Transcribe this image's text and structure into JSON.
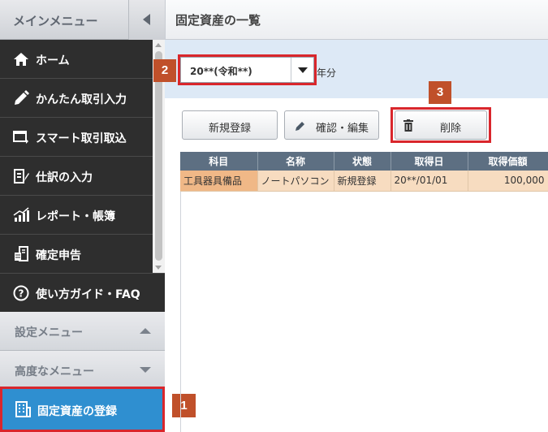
{
  "sidebar": {
    "header_title": "メインメニュー",
    "nav_items": [
      {
        "label": "ホーム",
        "icon": "home-icon"
      },
      {
        "label": "かんたん取引入力",
        "icon": "pencil-icon"
      },
      {
        "label": "スマート取引取込",
        "icon": "import-icon"
      },
      {
        "label": "仕訳の入力",
        "icon": "journal-icon"
      },
      {
        "label": "レポート・帳簿",
        "icon": "chart-icon"
      },
      {
        "label": "確定申告",
        "icon": "tax-return-icon"
      }
    ],
    "guide_label": "使い方ガイド・FAQ",
    "settings_label": "設定メニュー",
    "advanced_label": "高度なメニュー",
    "register_label": "固定資産の登録"
  },
  "page": {
    "title": "固定資産の一覧",
    "year_value": "20**(令和**)",
    "year_suffix": "年分"
  },
  "toolbar": {
    "new_label": "新規登録",
    "edit_label": "確認・編集",
    "delete_label": "削除"
  },
  "table": {
    "headers": [
      "科目",
      "名称",
      "状態",
      "取得日",
      "取得価額"
    ],
    "rows": [
      [
        "工具器具備品",
        "ノートパソコン",
        "新規登録",
        "20**/01/01",
        "100,000"
      ]
    ]
  },
  "annotations": {
    "step1": "1",
    "step2": "2",
    "step3": "3"
  },
  "colors": {
    "highlight": "#d9262c",
    "badge": "#c0502a",
    "selected_menu": "#2f8fd0",
    "selected_row": "#f7dcc0",
    "table_header": "#5d6f82"
  }
}
